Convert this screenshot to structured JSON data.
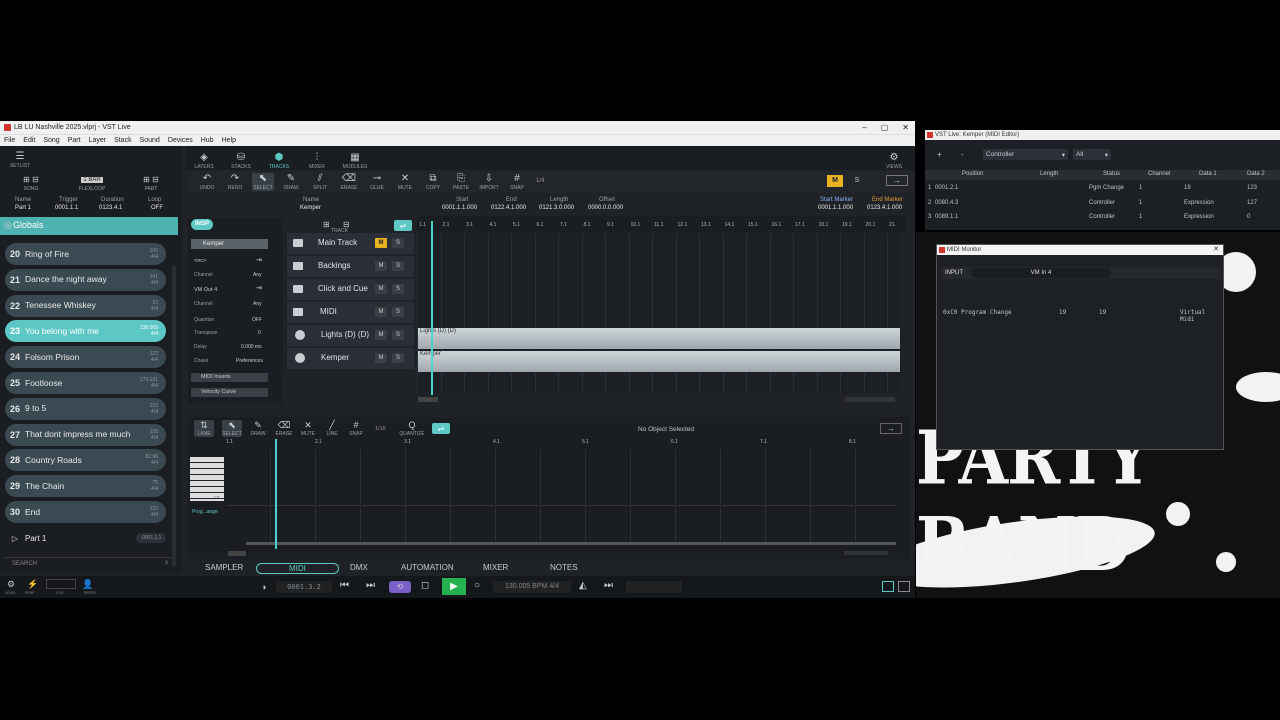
{
  "window": {
    "title": "LB LU Nashville 2025.vlprj - VST Live",
    "controls": [
      "–",
      "▢",
      "✕"
    ]
  },
  "menu": [
    "File",
    "Edit",
    "Song",
    "Part",
    "Layer",
    "Stack",
    "Sound",
    "Devices",
    "Hub",
    "Help"
  ],
  "nav_tabs": [
    {
      "label": "SETLIST",
      "icon": "list-icon"
    },
    {
      "label": "LAYERS",
      "icon": "layers-icon"
    },
    {
      "label": "STACKS",
      "icon": "stacks-icon"
    },
    {
      "label": "TRACKS",
      "icon": "tracks-icon"
    },
    {
      "label": "MIXER",
      "icon": "mixer-icon"
    },
    {
      "label": "MODULES",
      "icon": "modules-icon"
    },
    {
      "label": "VIEWS",
      "icon": "gear-icon"
    }
  ],
  "left_controls": {
    "song": "SONG",
    "flexloop": "FLEXLOOP",
    "one_bar": "1 BAR",
    "part": "PART"
  },
  "part_info": {
    "name_lbl": "Name",
    "name": "Part 1",
    "trigger_lbl": "Trigger",
    "trigger": "0001.1.1",
    "duration_lbl": "Duration",
    "duration": "0123.4.1",
    "loop_lbl": "Loop",
    "loop": "OFF"
  },
  "globals_label": "Globals",
  "setlist": [
    {
      "num": "20",
      "name": "Ring of Fire",
      "tempo": "106",
      "sig": "4/4"
    },
    {
      "num": "21",
      "name": "Dance the night away",
      "tempo": "141",
      "sig": "4/4"
    },
    {
      "num": "22",
      "name": "Tenessee Whiskey",
      "tempo": "53",
      "sig": "4/4"
    },
    {
      "num": "23",
      "name": "You belong with me",
      "tempo": "130.005",
      "sig": "4/4"
    },
    {
      "num": "24",
      "name": "Folsom Prison",
      "tempo": "122",
      "sig": "4/4"
    },
    {
      "num": "25",
      "name": "Footloose",
      "tempo": "173.191",
      "sig": "4/4"
    },
    {
      "num": "26",
      "name": "9 to 5",
      "tempo": "103",
      "sig": "4/4"
    },
    {
      "num": "27",
      "name": "That dont impress me much",
      "tempo": "125",
      "sig": "4/4"
    },
    {
      "num": "28",
      "name": "Country Roads",
      "tempo": "82.96",
      "sig": "4/4"
    },
    {
      "num": "29",
      "name": "The Chain",
      "tempo": "75",
      "sig": "4/4"
    },
    {
      "num": "30",
      "name": "End",
      "tempo": "120",
      "sig": "4/4"
    }
  ],
  "part_row": {
    "label": "Part 1",
    "time": "0001.1.1"
  },
  "search": {
    "placeholder": "SEARCH",
    "clear": "x"
  },
  "tools": [
    "UNDO",
    "REDO",
    "SELECT",
    "DRAW",
    "SPLIT",
    "ERASE",
    "GLUE",
    "MUTE",
    "COPY",
    "PASTE",
    "IMPORT",
    "SNAP"
  ],
  "snap_value": "1/4",
  "master": {
    "m": "M",
    "s": "S"
  },
  "event_info": {
    "name_lbl": "Name",
    "name": "Kemper",
    "start_lbl": "Start",
    "start": "0001.1.1.000",
    "end_lbl": "End",
    "end": "0122.4.1.000",
    "length_lbl": "Length",
    "length": "0121.3.0.000",
    "offset_lbl": "Offset",
    "offset": "0000.0.0.000",
    "start_marker_lbl": "Start Marker",
    "start_marker": "0001.1.1.000",
    "end_marker_lbl": "End Marker",
    "end_marker": "0123.4.1.000"
  },
  "inspector": {
    "insp": "INSP",
    "track_name": "Kemper",
    "nc": "<nc>",
    "channel_lbl": "Channel",
    "channel_in": "Any",
    "out": "VM Out 4",
    "channel_out": "Any",
    "quantize_lbl": "Quantize",
    "quantize": "OFF",
    "transpose_lbl": "Transpose",
    "transpose": "0",
    "delay_lbl": "Delay",
    "delay": "0.000 ms",
    "chase_lbl": "Chase",
    "chase": "Preferences",
    "midi_inserts": "MIDI Inserts",
    "velocity_curve": "Velocity Curve"
  },
  "track_label": "TRACK",
  "tracks": [
    {
      "name": "Main Track",
      "m_on": true
    },
    {
      "name": "Backings",
      "m_on": false
    },
    {
      "name": "Click and Cue",
      "m_on": false
    },
    {
      "name": "MIDI",
      "m_on": false
    },
    {
      "name": "Lights (D) (D)",
      "m_on": false
    },
    {
      "name": "Kemper",
      "m_on": false
    }
  ],
  "ruler_marks": [
    "1.1",
    "2.1",
    "3.1",
    "4.1",
    "5.1",
    "6.1",
    "7.1",
    "8.1",
    "9.1",
    "10.1",
    "11.1",
    "12.1",
    "13.1",
    "14.1",
    "15.1",
    "16.1",
    "17.1",
    "18.1",
    "19.1",
    "20.1",
    "21."
  ],
  "clips": [
    {
      "label": "Lights (D) (D)"
    },
    {
      "label": "Kemper"
    }
  ],
  "editor": {
    "tools": [
      "LANE",
      "SELECT",
      "DRAW",
      "ERASE",
      "MUTE",
      "LINE",
      "SNAP"
    ],
    "snap": "1/16",
    "quantize": "QUANTIZE",
    "status": "No Object Selected",
    "ruler": [
      "1.1",
      "2.1",
      "3.1",
      "4.1",
      "5.1",
      "6.1",
      "7.1",
      "8.1"
    ],
    "c_label": "C3",
    "lane_label": "Prog...ange"
  },
  "bottom_tabs": [
    "SAMPLER",
    "MIDI",
    "DMX",
    "AUTOMATION",
    "MIXER",
    "NOTES"
  ],
  "transport": {
    "position": "0001.3.2",
    "tempo": "130.005 BPM 4/4"
  },
  "status_icons": [
    "LEVEL",
    "PERF",
    "CPU",
    "PEERS"
  ],
  "midi_editor_window": {
    "title": "VST Live: Kemper (MIDI Editor)",
    "filter": "Controller",
    "filter2": "All",
    "columns": [
      "Position",
      "Length",
      "Status",
      "Channel",
      "Data 1",
      "Data 2"
    ],
    "rows": [
      {
        "idx": "1",
        "position": "0001.2.1",
        "length": "",
        "status": "Pgm Change",
        "channel": "1",
        "d1": "19",
        "d2": "123"
      },
      {
        "idx": "2",
        "position": "0080.4.3",
        "length": "",
        "status": "Controller",
        "channel": "1",
        "d1": "Expression",
        "d2": "127"
      },
      {
        "idx": "3",
        "position": "0089.1.1",
        "length": "",
        "status": "Controller",
        "channel": "1",
        "d1": "Expression",
        "d2": "0"
      }
    ]
  },
  "midi_monitor": {
    "title": "MIDI Monitor",
    "input_lbl": "INPUT",
    "input": "VM In 4",
    "line": {
      "code": "0xC0",
      "type": "Program Change",
      "d1": "19",
      "d2": "19",
      "port": "Virtual Midi"
    }
  },
  "background_text": "PARTY BAND"
}
